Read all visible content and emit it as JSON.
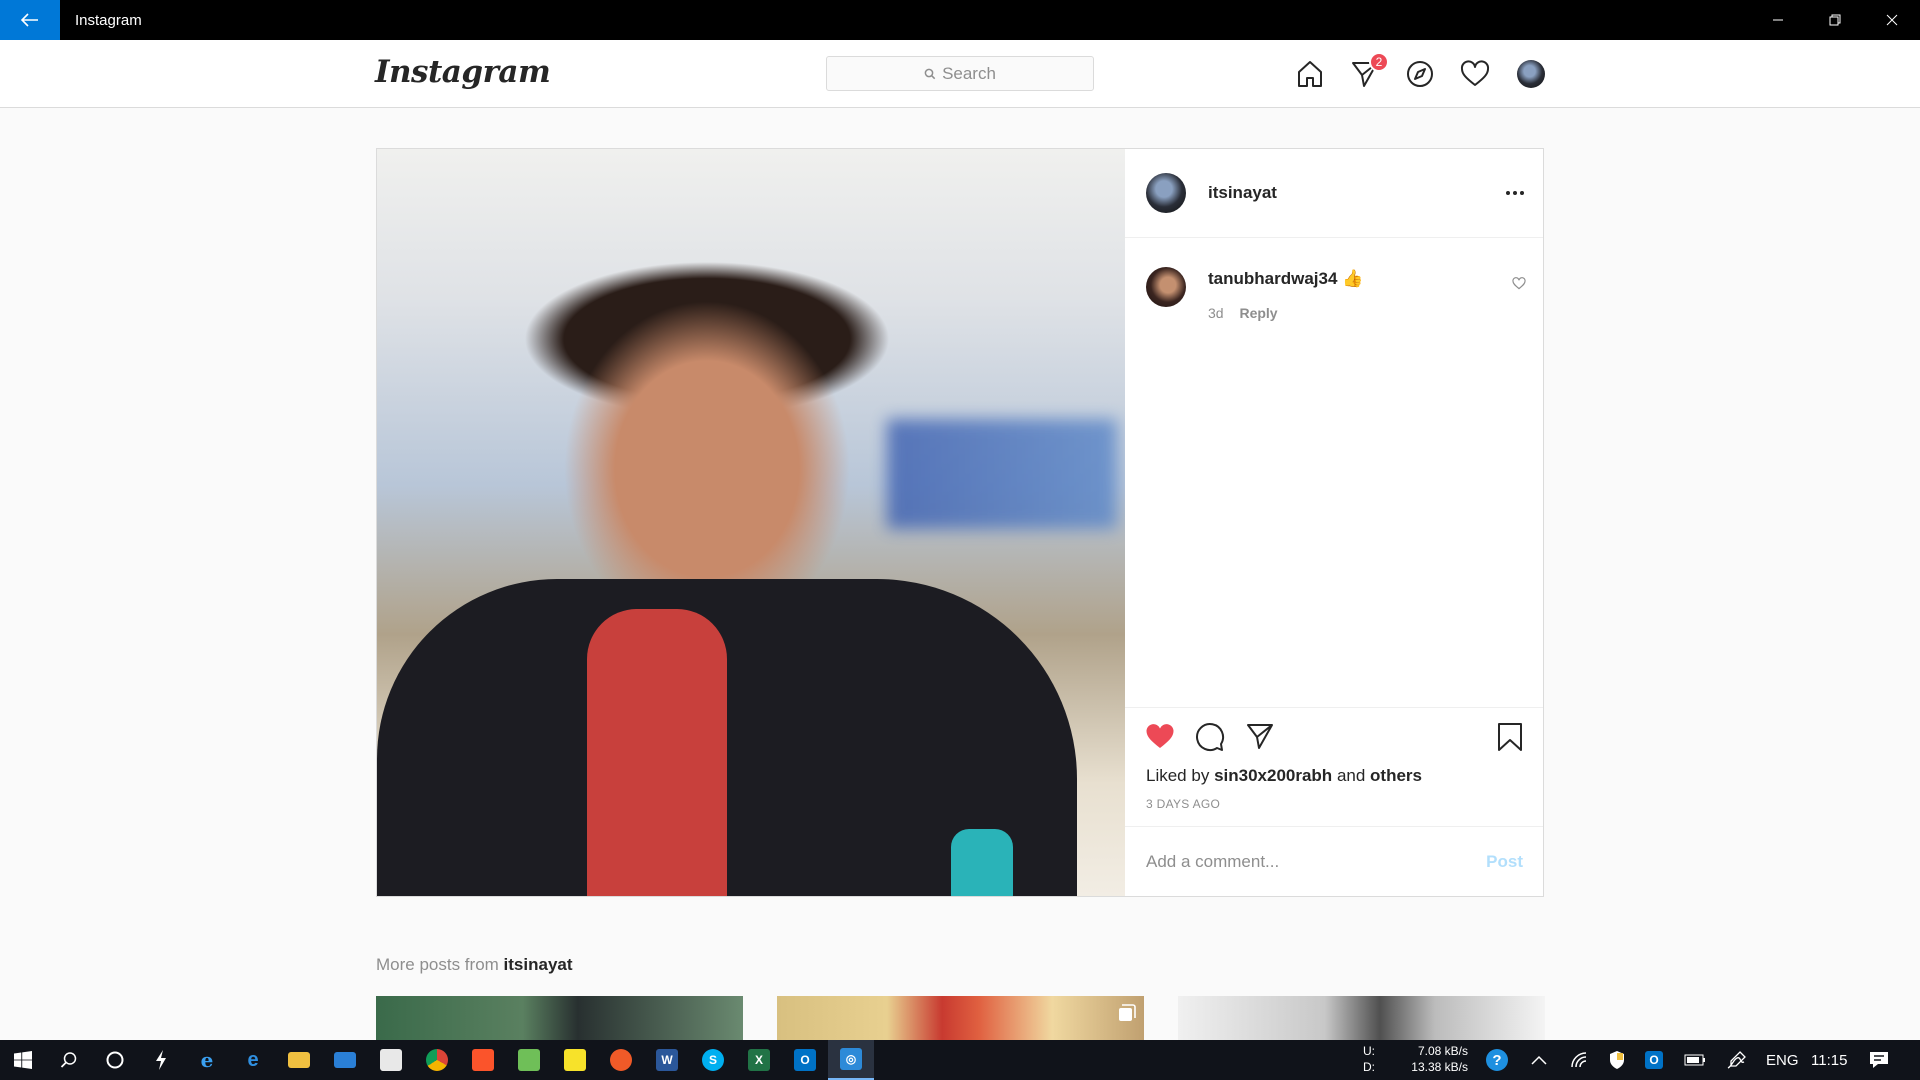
{
  "window": {
    "title": "Instagram"
  },
  "header": {
    "logo": "Instagram",
    "search_placeholder": "Search",
    "direct_badge": "2"
  },
  "post": {
    "author": "itsinayat",
    "comments": [
      {
        "user": "tanubhardwaj34",
        "text": "👍",
        "age": "3d",
        "reply_label": "Reply"
      }
    ],
    "liked_prefix": "Liked by",
    "liked_user": "sin30x200rabh",
    "liked_and": "and",
    "liked_others": "others",
    "timestamp": "3 DAYS AGO",
    "comment_placeholder": "Add a comment...",
    "post_button": "Post"
  },
  "more_posts": {
    "prefix": "More posts from",
    "user": "itsinayat"
  },
  "taskbar": {
    "upload_label": "U:",
    "upload_speed": "7.08 kB/s",
    "download_label": "D:",
    "download_speed": "13.38 kB/s",
    "language": "ENG",
    "clock": "11:15"
  },
  "colors": {
    "accent": "#0078d7",
    "like_red": "#ed4956",
    "badge_red": "#ed4956",
    "post_button": "#b2dffc"
  }
}
